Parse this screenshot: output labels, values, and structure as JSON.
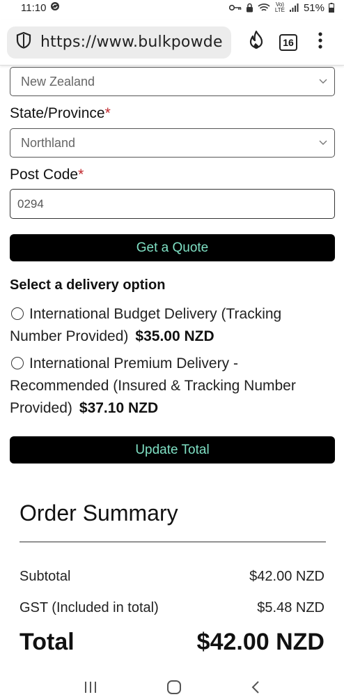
{
  "status": {
    "time": "11:10",
    "battery": "51%",
    "network": "Vo) LTE"
  },
  "browser": {
    "url": "https://www.bulkpowde",
    "tab_count": "16"
  },
  "form": {
    "country_value": "New Zealand",
    "state_label": "State/Province",
    "state_value": "Northland",
    "postcode_label": "Post Code",
    "postcode_value": "0294",
    "required_mark": "*",
    "quote_button": "Get a Quote"
  },
  "delivery": {
    "title": "Select a delivery option",
    "options": [
      {
        "label": "International Budget Delivery (Tracking Number Provided)",
        "price": "$35.00 NZD"
      },
      {
        "label": "International Premium Delivery - Recommended (Insured & Tracking Number Provided)",
        "price": "$37.10 NZD"
      }
    ],
    "update_button": "Update Total"
  },
  "summary": {
    "title": "Order Summary",
    "subtotal_label": "Subtotal",
    "subtotal_value": "$42.00 NZD",
    "gst_label": "GST (Included in total)",
    "gst_value": "$5.48 NZD",
    "total_label": "Total",
    "total_value": "$42.00 NZD"
  },
  "icons": {
    "shield": "shield-icon",
    "fire": "fire-icon",
    "menu": "more-vert-icon"
  }
}
